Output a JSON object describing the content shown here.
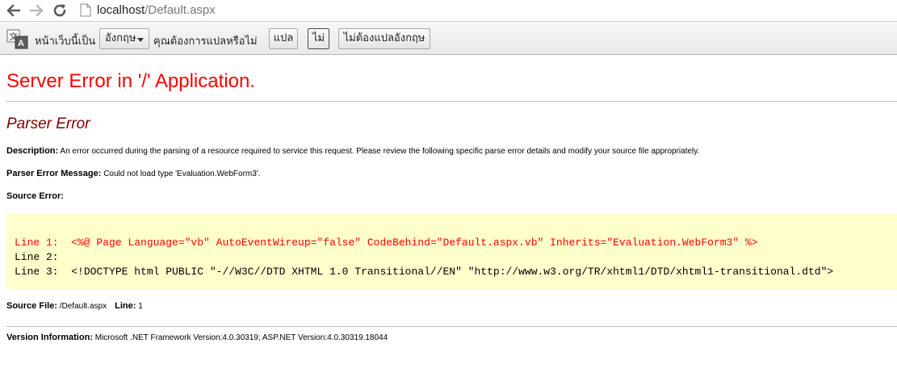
{
  "browser": {
    "url_host": "localhost",
    "url_path": "/Default.aspx"
  },
  "translate_bar": {
    "text_page_is": "หน้าเว็บนี้เป็น",
    "language_selected": "อังกฤษ",
    "text_question": "คุณต้องการแปลหรือไม่",
    "translate_label": "แปล",
    "no_label": "ไม่",
    "never_translate_label": "ไม่ต้องแปลอังกฤษ"
  },
  "error_page": {
    "heading": "Server Error in '/' Application.",
    "subheading": "Parser Error",
    "description_label": "Description:",
    "description_text": "An error occurred during the parsing of a resource required to service this request. Please review the following specific parse error details and modify your source file appropriately.",
    "message_label": "Parser Error Message:",
    "message_text": "Could not load type 'Evaluation.WebForm3'.",
    "source_error_label": "Source Error:",
    "source_lines": [
      "Line 1:  <%@ Page Language=\"vb\" AutoEventWireup=\"false\" CodeBehind=\"Default.aspx.vb\" Inherits=\"Evaluation.WebForm3\" %>",
      "Line 2:",
      "Line 3:  <!DOCTYPE html PUBLIC \"-//W3C//DTD XHTML 1.0 Transitional//EN\" \"http://www.w3.org/TR/xhtml1/DTD/xhtml1-transitional.dtd\">"
    ],
    "source_file_label": "Source File:",
    "source_file_value": "/Default.aspx",
    "line_label": "Line:",
    "line_value": "1",
    "version_label": "Version Information:",
    "version_text": "Microsoft .NET Framework Version:4.0.30319; ASP.NET Version:4.0.30319.18044"
  },
  "colors": {
    "heading": "#ff0000",
    "subheading": "#800000",
    "code_background": "#ffffcc",
    "highlighted_line": "#ff0000"
  }
}
